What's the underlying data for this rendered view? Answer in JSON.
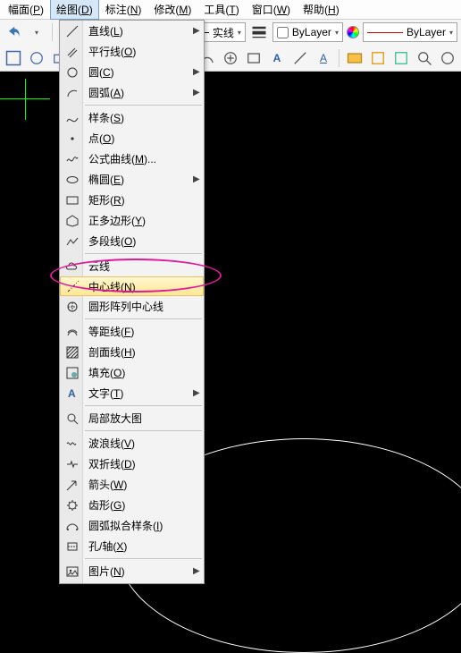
{
  "menubar": {
    "items": [
      {
        "label": "幅面",
        "hot": "P"
      },
      {
        "label": "绘图",
        "hot": "D"
      },
      {
        "label": "标注",
        "hot": "N"
      },
      {
        "label": "修改",
        "hot": "M"
      },
      {
        "label": "工具",
        "hot": "T"
      },
      {
        "label": "窗口",
        "hot": "W"
      },
      {
        "label": "帮助",
        "hot": "H"
      }
    ]
  },
  "toolbar": {
    "linestyle_label": "实线",
    "layer_label": "ByLayer",
    "layer_label2": "ByLayer"
  },
  "dropdown": {
    "items": [
      {
        "label": "直线",
        "hot": "L",
        "sub": true,
        "icon": "line"
      },
      {
        "label": "平行线",
        "hot": "O",
        "icon": "parallel"
      },
      {
        "label": "圆",
        "hot": "C",
        "sub": true,
        "icon": "circle"
      },
      {
        "label": "圆弧",
        "hot": "A",
        "sub": true,
        "icon": "arc"
      },
      {
        "sep": true
      },
      {
        "label": "样条",
        "hot": "S",
        "icon": "spline"
      },
      {
        "label": "点",
        "hot": "O",
        "icon": "point"
      },
      {
        "label": "公式曲线",
        "hot": "M",
        "dots": true,
        "icon": "formula"
      },
      {
        "label": "椭圆",
        "hot": "E",
        "sub": true,
        "icon": "ellipse"
      },
      {
        "label": "矩形",
        "hot": "R",
        "icon": "rect"
      },
      {
        "label": "正多边形",
        "hot": "Y",
        "icon": "polygon"
      },
      {
        "label": "多段线",
        "hot": "O",
        "icon": "polyline"
      },
      {
        "sep": true
      },
      {
        "label": "云线",
        "icon": "cloud"
      },
      {
        "label": "中心线",
        "hot": "N",
        "highlight": true,
        "icon": "centerline"
      },
      {
        "label": "圆形阵列中心线",
        "icon": "circpat"
      },
      {
        "sep": true
      },
      {
        "label": "等距线",
        "hot": "F",
        "icon": "offset"
      },
      {
        "label": "剖面线",
        "hot": "H",
        "icon": "hatch"
      },
      {
        "label": "填充",
        "hot": "O",
        "icon": "fill"
      },
      {
        "label": "文字",
        "hot": "T",
        "sub": true,
        "icon": "text"
      },
      {
        "sep": true
      },
      {
        "label": "局部放大图",
        "icon": "zoomdetail"
      },
      {
        "sep": true
      },
      {
        "label": "波浪线",
        "hot": "V",
        "icon": "wave"
      },
      {
        "label": "双折线",
        "hot": "D",
        "icon": "break"
      },
      {
        "label": "箭头",
        "hot": "W",
        "icon": "arrow"
      },
      {
        "label": "齿形",
        "hot": "G",
        "icon": "gear"
      },
      {
        "label": "圆弧拟合样条",
        "hot": "I",
        "icon": "arcfit"
      },
      {
        "label": "孔/轴",
        "hot": "X",
        "icon": "hole"
      },
      {
        "sep": true
      },
      {
        "label": "图片",
        "hot": "N",
        "sub": true,
        "icon": "image"
      }
    ]
  }
}
